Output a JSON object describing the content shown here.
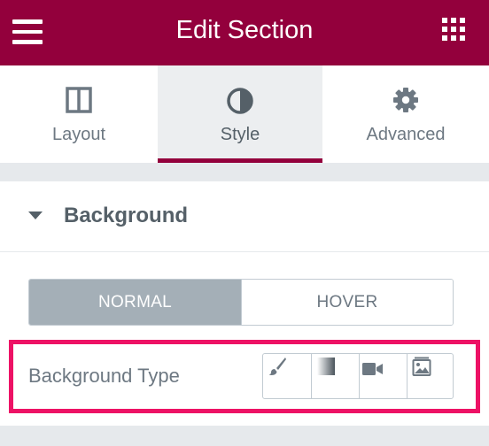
{
  "header": {
    "title": "Edit Section",
    "menu_icon": "hamburger-menu-icon",
    "widgets_icon": "grid-apps-icon",
    "color": "#93003c"
  },
  "tabs": [
    {
      "label": "Layout",
      "icon": "columns-layout-icon",
      "active": false
    },
    {
      "label": "Style",
      "icon": "half-circle-contrast-icon",
      "active": true
    },
    {
      "label": "Advanced",
      "icon": "gear-icon",
      "active": false
    }
  ],
  "section": {
    "title": "Background",
    "expanded": true,
    "state_tabs": [
      {
        "label": "NORMAL",
        "active": true
      },
      {
        "label": "HOVER",
        "active": false
      }
    ],
    "background_type": {
      "label": "Background Type",
      "options": [
        {
          "icon": "paint-brush-icon",
          "name": "Classic"
        },
        {
          "icon": "gradient-icon",
          "name": "Gradient"
        },
        {
          "icon": "video-camera-icon",
          "name": "Video"
        },
        {
          "icon": "slideshow-icon",
          "name": "Slideshow"
        }
      ]
    }
  },
  "colors": {
    "accent": "#93003c",
    "highlight": "#ed1265",
    "text": "#6d7882",
    "active_segment": "#a4afb7"
  }
}
